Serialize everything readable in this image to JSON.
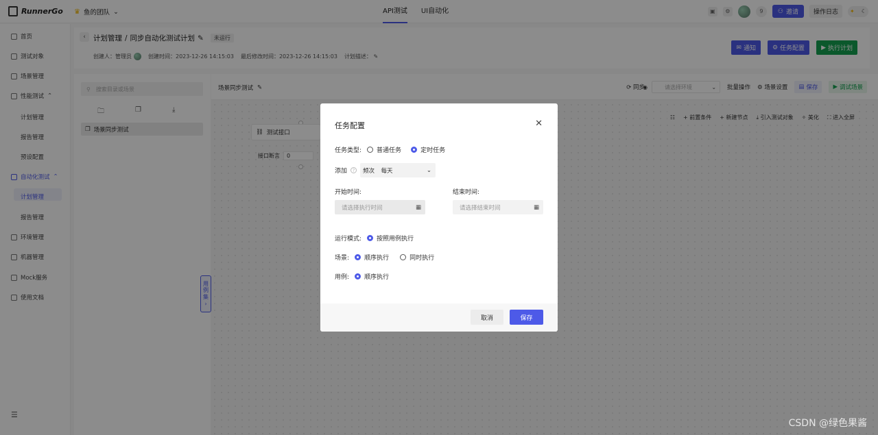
{
  "app": {
    "name": "RunnerGo",
    "team": "鱼的团队"
  },
  "topnav": {
    "tabs": [
      "API测试",
      "UI自动化"
    ],
    "active": 0
  },
  "topright": {
    "count": "9",
    "invite": "邀请",
    "log": "操作日志"
  },
  "sidebar": {
    "items": [
      {
        "label": "首页"
      },
      {
        "label": "测试对象"
      },
      {
        "label": "场景管理"
      },
      {
        "label": "性能测试"
      },
      {
        "label": "计划管理"
      },
      {
        "label": "报告管理"
      },
      {
        "label": "预设配置"
      },
      {
        "label": "自动化测试"
      },
      {
        "label": "计划管理"
      },
      {
        "label": "报告管理"
      },
      {
        "label": "环境管理"
      },
      {
        "label": "机器管理"
      },
      {
        "label": "Mock服务"
      },
      {
        "label": "使用文档"
      }
    ]
  },
  "header": {
    "crumb_root": "计划管理",
    "separator": "/",
    "plan_name": "同步自动化测试计划",
    "status": "未运行",
    "creator": "创建人：管理员",
    "created": "创建时间：2023-12-26 14:15:03",
    "modified": "最后修改时间：2023-12-26 14:15:03",
    "desc": "计划描述：",
    "btn_notify": "通知",
    "btn_task": "任务配置",
    "btn_run": "执行计划"
  },
  "left_panel": {
    "search_placeholder": "搜索目录或场景",
    "scene": "场景同步测试",
    "side_tab": [
      "用",
      "例",
      "集",
      "›"
    ]
  },
  "canvas": {
    "title": "场景同步测试",
    "sync": "同步",
    "env_placeholder": "请选择环境",
    "batch": "批量操作",
    "scene_settings": "场景设置",
    "save": "保存",
    "debug": "调试场景",
    "tools": [
      "前置条件",
      "新建节点",
      "引入测试对象",
      "美化",
      "进入全屏"
    ],
    "node_label": "测试接口",
    "assert_label": "接口断言",
    "assert_value": "0"
  },
  "modal": {
    "title": "任务配置",
    "task_type_label": "任务类型:",
    "task_type_options": [
      "普通任务",
      "定时任务"
    ],
    "task_type_selected": 1,
    "add_label": "添加",
    "freq_label": "频次",
    "freq_value": "每天",
    "start_label": "开始时间:",
    "start_placeholder": "请选择执行时间",
    "end_label": "结束时间:",
    "end_placeholder": "请选择结束时间",
    "run_mode_label": "运行模式:",
    "run_mode_value": "按照用例执行",
    "scene_label": "场景:",
    "scene_options": [
      "顺序执行",
      "同时执行"
    ],
    "scene_selected": 0,
    "case_label": "用例:",
    "case_value": "顺序执行",
    "cancel": "取消",
    "save": "保存"
  },
  "watermark": "CSDN @绿色果酱",
  "colors": {
    "accent": "#4d5ae8",
    "success": "#14a150"
  }
}
